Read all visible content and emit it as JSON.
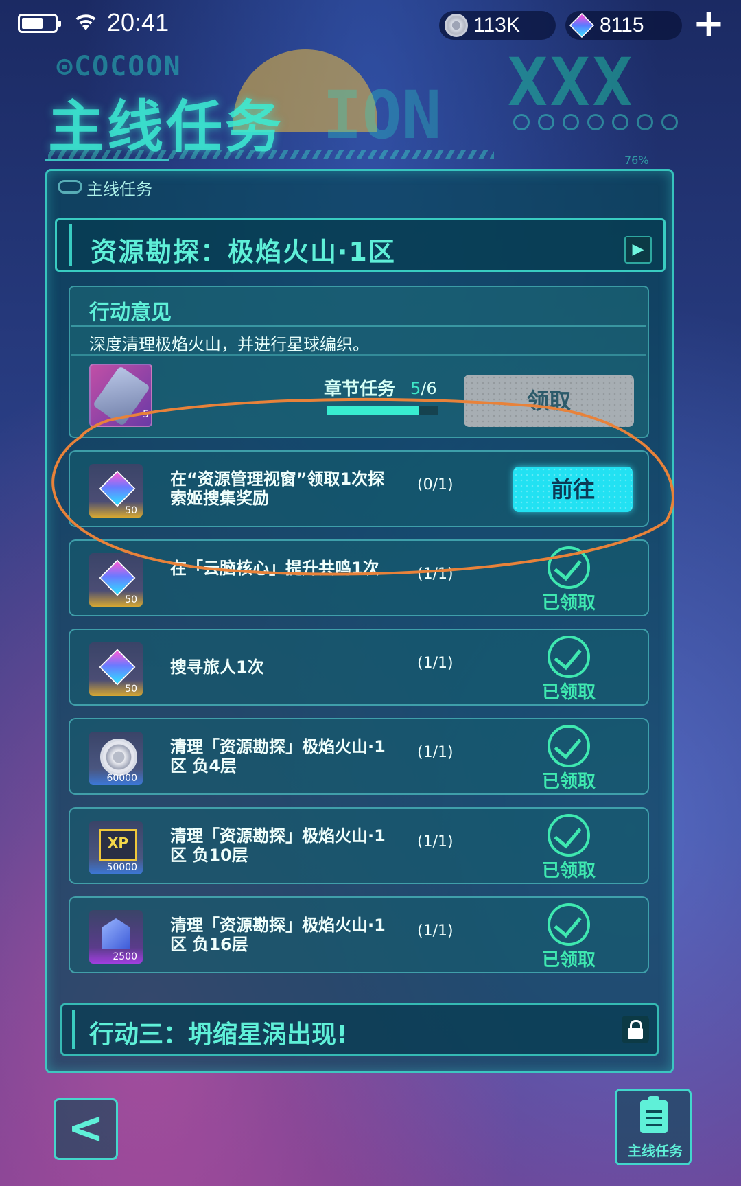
{
  "status_bar": {
    "time": "20:41",
    "coins": "113K",
    "gems": "8115",
    "plus": "+"
  },
  "header": {
    "decor_brand": "⊙COCOON",
    "big_title": "主线任务",
    "decor_ion": "ION",
    "decor_xxx": "XXX",
    "decor_percent": "76%"
  },
  "panel": {
    "label": "主线任务",
    "chapter_title": "资源勘探：极焰火山·1区",
    "section": {
      "title": "行动意见",
      "description": "深度清理极焰火山，并进行星球编织。",
      "reward_qty": "5",
      "chapter_task_label": "章节任务",
      "progress_current": "5",
      "progress_total": "/6",
      "progress_fraction": 0.833,
      "claim_label": "领取"
    },
    "tasks": [
      {
        "desc": "在“资源管理视窗”领取1次探索姬搜集奖励",
        "progress": "(0/1)",
        "reward_qty": "50",
        "status": "go",
        "action_label": "前往"
      },
      {
        "desc": "在「云脑核心」提升共鸣1次",
        "progress": "(1/1)",
        "reward_qty": "50",
        "status": "claimed",
        "action_label": "已领取"
      },
      {
        "desc": "搜寻旅人1次",
        "progress": "(1/1)",
        "reward_qty": "50",
        "status": "claimed",
        "action_label": "已领取"
      },
      {
        "desc": "清理「资源勘探」极焰火山·1区 负4层",
        "progress": "(1/1)",
        "reward_qty": "60000",
        "status": "claimed",
        "action_label": "已领取"
      },
      {
        "desc": "清理「资源勘探」极焰火山·1区 负10层",
        "progress": "(1/1)",
        "reward_qty": "50000",
        "status": "claimed",
        "action_label": "已领取"
      },
      {
        "desc": "清理「资源勘探」极焰火山·1区 负16层",
        "progress": "(1/1)",
        "reward_qty": "2500",
        "status": "claimed",
        "action_label": "已领取"
      }
    ],
    "locked_chapter_title": "行动三：坍缩星涡出现!"
  },
  "bottom_nav": {
    "back_symbol": "<",
    "main_quest_label": "主线任务"
  },
  "icons": {
    "battery": "battery-icon",
    "wifi": "wifi-icon",
    "coin": "coin-icon",
    "gem": "gem-icon",
    "play": "play-icon",
    "lock": "lock-icon",
    "clipboard": "clipboard-icon",
    "check": "check-icon"
  },
  "colors": {
    "accent": "#5ff0d8",
    "go_button": "#22e1f2",
    "claimed": "#3fe8b0",
    "annotation": "#e8823a"
  }
}
